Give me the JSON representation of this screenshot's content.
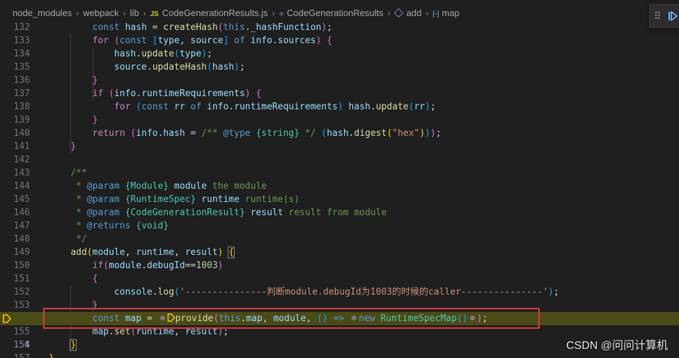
{
  "breadcrumb": {
    "items": [
      "node_modules",
      "webpack",
      "lib",
      "CodeGenerationResults.js",
      "CodeGenerationResults",
      "add",
      "map"
    ]
  },
  "lines": {
    "132": "132",
    "133": "133",
    "134": "134",
    "135": "135",
    "136": "136",
    "137": "137",
    "138": "138",
    "139": "139",
    "140": "140",
    "141": "141",
    "142": "142",
    "143": "143",
    "144": "144",
    "145": "145",
    "146": "146",
    "147": "147",
    "148": "148",
    "149": "149",
    "150": "150",
    "151": "151",
    "152": "152",
    "153": "153",
    "154": "154",
    "155": "155",
    "156": "156",
    "157": "157"
  },
  "strings": {
    "hex": "\"hex\"",
    "log_message": "'---------------判断module.debugId为1003的时候的caller---------------'",
    "debug_id": "1003"
  },
  "watermark": "CSDN @问问计算机",
  "colors": {
    "highlight_border": "#e03a3a",
    "current_line": "#4b4b18"
  }
}
